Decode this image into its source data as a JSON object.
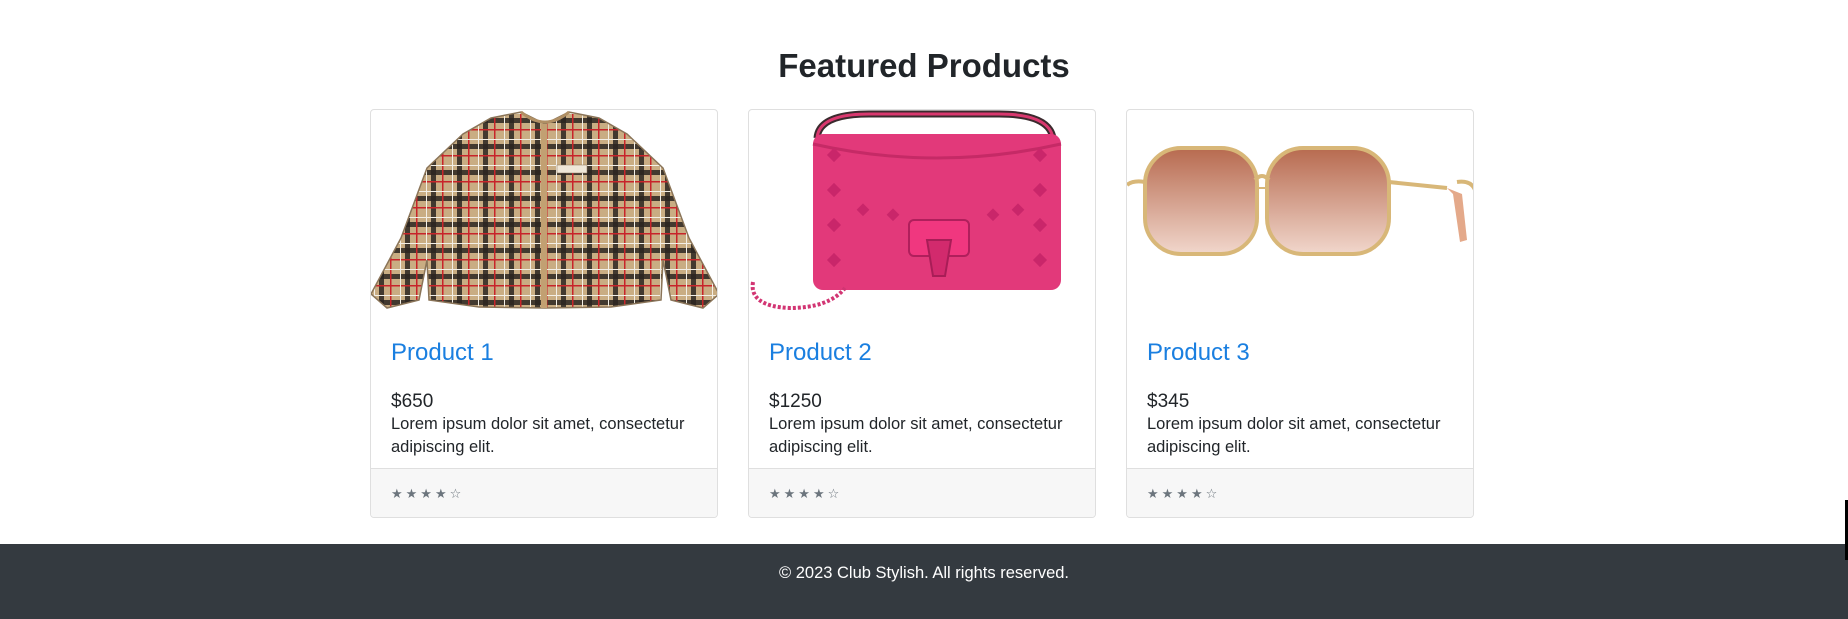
{
  "section": {
    "title": "Featured Products"
  },
  "products": [
    {
      "title": "Product 1",
      "price": "$650",
      "description": "Lorem ipsum dolor sit amet, consectetur adipiscing elit.",
      "rating": "★★★★☆",
      "image_icon": "plaid-jacket"
    },
    {
      "title": "Product 2",
      "price": "$1250",
      "description": "Lorem ipsum dolor sit amet, consectetur adipiscing elit.",
      "rating": "★★★★☆",
      "image_icon": "pink-handbag"
    },
    {
      "title": "Product 3",
      "price": "$345",
      "description": "Lorem ipsum dolor sit amet, consectetur adipiscing elit.",
      "rating": "★★★★☆",
      "image_icon": "sunglasses"
    }
  ],
  "footer": {
    "text": "© 2023 Club Stylish. All rights reserved."
  },
  "colors": {
    "link": "#1a7fe0",
    "footer_bg": "#343a40",
    "card_footer_bg": "#f7f7f7",
    "text": "#212529"
  }
}
